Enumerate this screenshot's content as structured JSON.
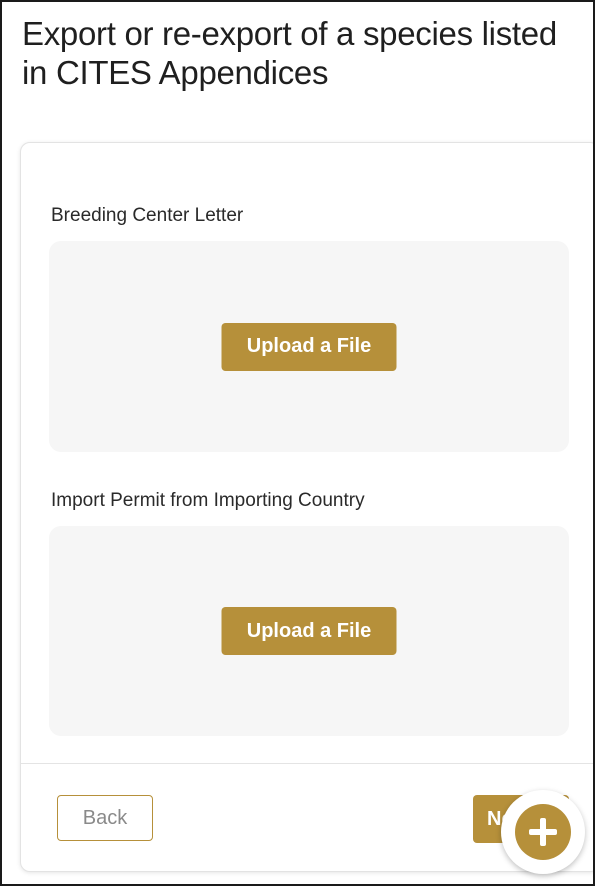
{
  "page": {
    "title": "Export or re-export of a species listed in CITES Appendices"
  },
  "form": {
    "fields": [
      {
        "label": "Breeding Center Letter",
        "button_label": "Upload a File"
      },
      {
        "label": "Import Permit from Importing Country",
        "button_label": "Upload a File"
      }
    ]
  },
  "footer": {
    "back_label": "Back",
    "next_label": "Next"
  },
  "fab": {
    "icon": "plus-circle-icon"
  },
  "colors": {
    "accent": "#b6903a",
    "upload_zone_bg": "#f6f6f6",
    "text": "#1f1f1f"
  }
}
